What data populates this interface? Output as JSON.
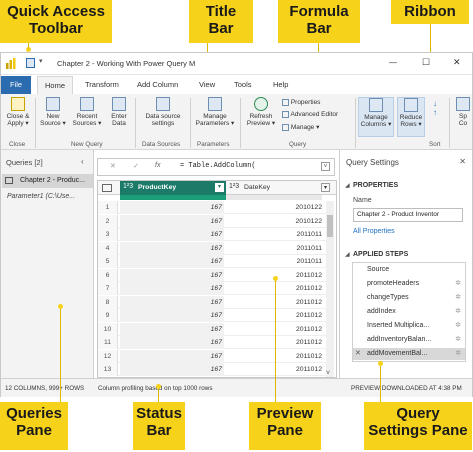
{
  "callouts": {
    "quick_access_toolbar": "Quick Access\nToolbar",
    "title_bar": "Title\nBar",
    "formula_bar": "Formula\nBar",
    "ribbon": "Ribbon",
    "queries_pane": "Queries\nPane",
    "status_bar": "Status\nBar",
    "preview_pane": "Preview\nPane",
    "query_settings_pane": "Query\nSettings Pane"
  },
  "window": {
    "title": "Chapter 2 - Working With Power Query M",
    "controls": {
      "minimize": "—",
      "maximize": "☐",
      "close": "✕"
    }
  },
  "tabs": [
    "File",
    "Home",
    "Transform",
    "Add Column",
    "View",
    "Tools",
    "Help"
  ],
  "ribbon": {
    "close_apply": "Close &\nApply ▾",
    "new_source": "New\nSource ▾",
    "recent_sources": "Recent\nSources ▾",
    "enter_data": "Enter\nData",
    "data_source_settings": "Data source\nsettings",
    "manage_parameters": "Manage\nParameters ▾",
    "refresh_preview": "Refresh\nPreview ▾",
    "properties": "Properties",
    "advanced_editor": "Advanced Editor",
    "manage": "Manage ▾",
    "manage_columns": "Manage\nColumns ▾",
    "reduce_rows": "Reduce\nRows ▾",
    "groups": {
      "close": "Close",
      "new_query": "New Query",
      "data_sources": "Data Sources",
      "parameters": "Parameters",
      "query": "Query",
      "sort": "Sort"
    }
  },
  "queries": {
    "header": "Queries [2]",
    "items": [
      "Chapter 2 - Produc...",
      "Parameter1 (C:\\Use..."
    ]
  },
  "formula": {
    "text": "= Table.AddColumn(",
    "cancel": "✕",
    "confirm": "✓",
    "fx": "fx"
  },
  "grid": {
    "columns": [
      {
        "type": "1²3",
        "name": "ProductKey"
      },
      {
        "type": "1²3",
        "name": "DateKey"
      }
    ],
    "rows": [
      [
        "1",
        "167",
        "2010122"
      ],
      [
        "2",
        "167",
        "2010122"
      ],
      [
        "3",
        "167",
        "2011011"
      ],
      [
        "4",
        "167",
        "2011011"
      ],
      [
        "5",
        "167",
        "2011011"
      ],
      [
        "6",
        "167",
        "2011012"
      ],
      [
        "7",
        "167",
        "2011012"
      ],
      [
        "8",
        "167",
        "2011012"
      ],
      [
        "9",
        "167",
        "2011012"
      ],
      [
        "10",
        "167",
        "2011012"
      ],
      [
        "11",
        "167",
        "2011012"
      ],
      [
        "12",
        "167",
        "2011012"
      ],
      [
        "13",
        "167",
        "2011012"
      ]
    ]
  },
  "settings": {
    "header": "Query Settings",
    "properties_title": "PROPERTIES",
    "name_label": "Name",
    "name_value": "Chapter 2 - Product Inventor",
    "all_properties": "All Properties",
    "applied_steps_title": "APPLIED STEPS",
    "steps": [
      "Source",
      "promoteHeaders",
      "changeTypes",
      "addIndex",
      "Inserted Multiplica...",
      "addInventoryBalan...",
      "addMovementBal..."
    ]
  },
  "status": {
    "left": "12 COLUMNS, 999+ ROWS",
    "middle": "Column profiling based on top 1000 rows",
    "right": "PREVIEW DOWNLOADED AT 4:38 PM"
  },
  "colors": {
    "callout": "#f6d21a",
    "accent": "#1f6fbf",
    "header_green": "#1b7a68",
    "file_tab": "#2b6cb0"
  }
}
